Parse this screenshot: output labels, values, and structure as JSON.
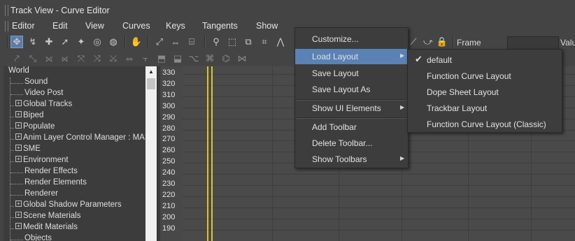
{
  "window": {
    "title": "Track View - Curve Editor"
  },
  "menubar": [
    "Editor",
    "Edit",
    "View",
    "Curves",
    "Keys",
    "Tangents",
    "Show"
  ],
  "toolbar": {
    "frame_label": "Frame",
    "value_label": "Valu"
  },
  "tree": {
    "root": "World",
    "items": [
      {
        "label": "Sound",
        "expandable": false
      },
      {
        "label": "Video Post",
        "expandable": false
      },
      {
        "label": "Global Tracks",
        "expandable": true
      },
      {
        "label": "Biped",
        "expandable": true
      },
      {
        "label": "Populate",
        "expandable": true
      },
      {
        "label": "Anim Layer Control Manager : MASTE",
        "expandable": true
      },
      {
        "label": "SME",
        "expandable": true
      },
      {
        "label": "Environment",
        "expandable": true
      },
      {
        "label": "Render Effects",
        "expandable": false
      },
      {
        "label": "Render Elements",
        "expandable": false
      },
      {
        "label": "Renderer",
        "expandable": false
      },
      {
        "label": "Global Shadow Parameters",
        "expandable": true
      },
      {
        "label": "Scene Materials",
        "expandable": true
      },
      {
        "label": "Medit Materials",
        "expandable": true
      },
      {
        "label": "Objects",
        "expandable": false
      }
    ]
  },
  "graph": {
    "y_labels": [
      "330",
      "320",
      "310",
      "300",
      "290",
      "280",
      "270",
      "260",
      "250",
      "240",
      "230",
      "220",
      "210",
      "200",
      "190"
    ]
  },
  "dropdown": {
    "items": [
      {
        "label": "Customize...",
        "submenu": false,
        "highlighted": false
      },
      {
        "label": "Load Layout",
        "submenu": true,
        "highlighted": true
      },
      {
        "label": "Save Layout",
        "submenu": false,
        "highlighted": false
      },
      {
        "label": "Save Layout As",
        "submenu": false,
        "highlighted": false
      },
      {
        "label": "Show UI Elements",
        "submenu": true,
        "highlighted": false
      },
      {
        "label": "Add Toolbar",
        "submenu": false,
        "highlighted": false
      },
      {
        "label": "Delete Toolbar...",
        "submenu": false,
        "highlighted": false
      },
      {
        "label": "Show Toolbars",
        "submenu": true,
        "highlighted": false
      }
    ]
  },
  "submenu": {
    "items": [
      {
        "label": "default",
        "checked": true
      },
      {
        "label": "Function Curve Layout",
        "checked": false
      },
      {
        "label": "Dope Sheet Layout",
        "checked": false
      },
      {
        "label": "Trackbar Layout",
        "checked": false
      },
      {
        "label": "Function Curve Layout (Classic)",
        "checked": false
      }
    ]
  },
  "colors": {
    "highlight": "#5a82b4",
    "accent_line": "#d9c62a",
    "panel": "#444444"
  }
}
